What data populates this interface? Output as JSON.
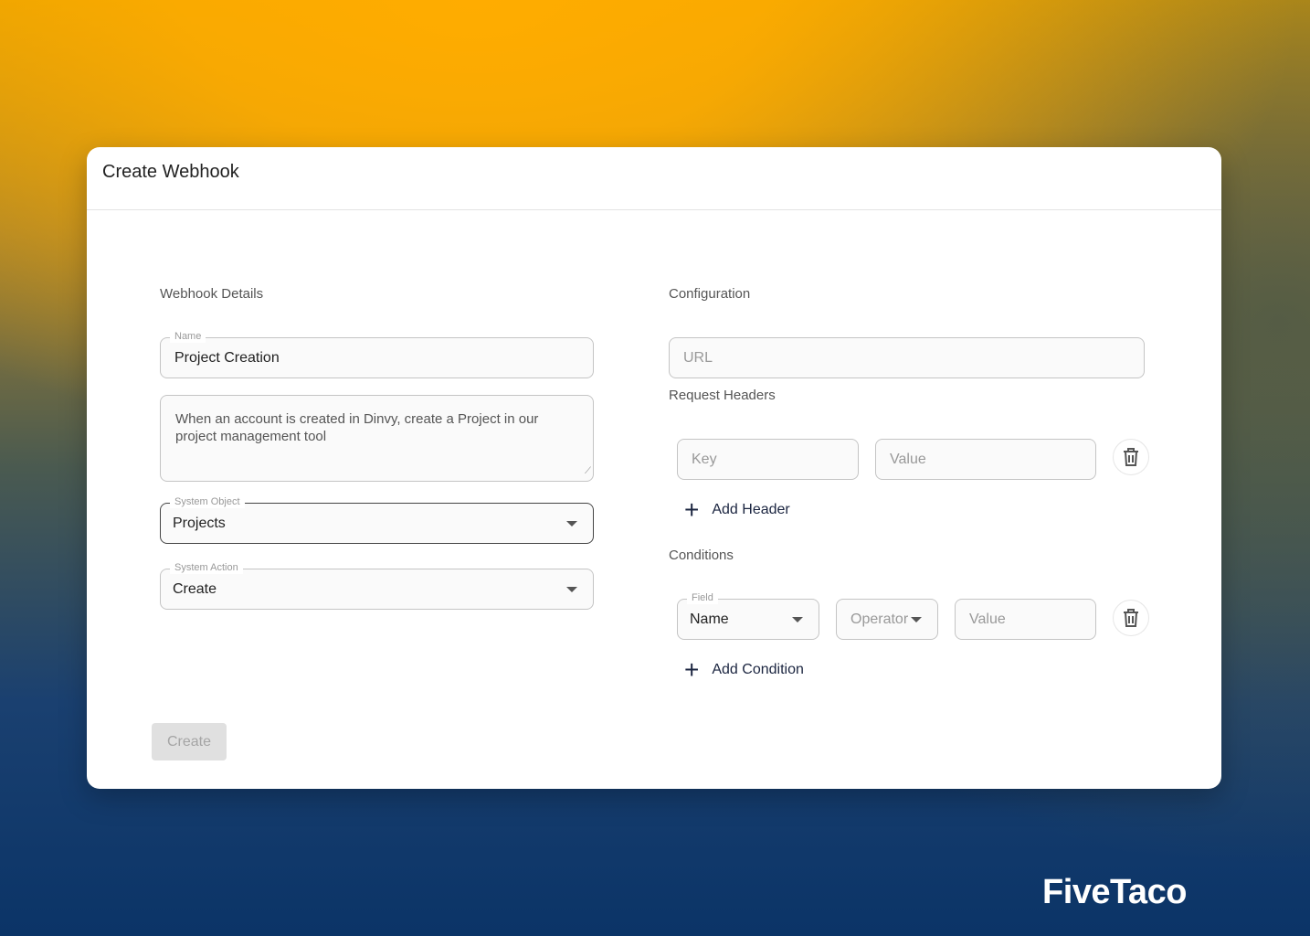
{
  "dialog": {
    "title": "Create Webhook"
  },
  "details": {
    "heading": "Webhook Details",
    "name": {
      "label": "Name",
      "value": "Project Creation"
    },
    "description": {
      "value": "When an account is created in Dinvy, create a Project in our project management tool"
    },
    "system_object": {
      "label": "System Object",
      "value": "Projects"
    },
    "system_action": {
      "label": "System Action",
      "value": "Create"
    }
  },
  "config": {
    "heading": "Configuration",
    "url": {
      "placeholder": "URL"
    },
    "headers_heading": "Request Headers",
    "header_key_placeholder": "Key",
    "header_value_placeholder": "Value",
    "add_header": "Add Header",
    "conditions_heading": "Conditions",
    "condition_field": {
      "label": "Field",
      "value": "Name"
    },
    "condition_operator_placeholder": "Operator",
    "condition_value_placeholder": "Value",
    "add_condition": "Add Condition"
  },
  "create_button": "Create",
  "brand": "FiveTaco"
}
